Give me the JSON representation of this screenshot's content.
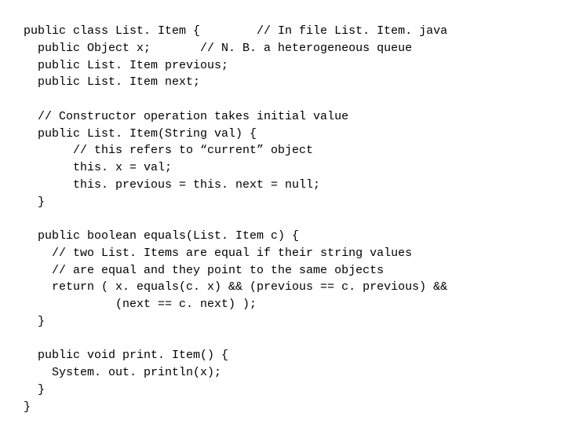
{
  "code": {
    "lines": [
      "public class List. Item {        // In file List. Item. java",
      "  public Object x;       // N. B. a heterogeneous queue",
      "  public List. Item previous;",
      "  public List. Item next;",
      "",
      "  // Constructor operation takes initial value",
      "  public List. Item(String val) {",
      "       // this refers to “current” object",
      "       this. x = val;",
      "       this. previous = this. next = null;",
      "  }",
      "",
      "  public boolean equals(List. Item c) {",
      "    // two List. Items are equal if their string values",
      "    // are equal and they point to the same objects",
      "    return ( x. equals(c. x) && (previous == c. previous) &&",
      "             (next == c. next) );",
      "  }",
      "",
      "  public void print. Item() {",
      "    System. out. println(x);",
      "  }",
      "}"
    ]
  }
}
